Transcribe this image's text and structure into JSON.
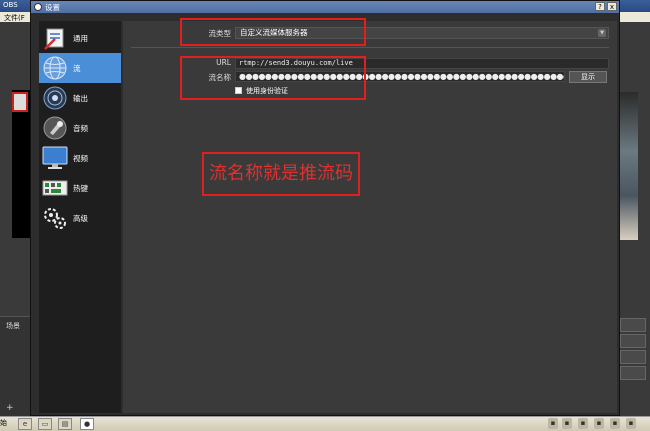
{
  "main_window": {
    "title": "OBS",
    "menu_item": "文件(F",
    "scene_label": "场景",
    "add_button": "+",
    "remove_button": "−"
  },
  "dialog": {
    "title": "设置",
    "controls": [
      "?",
      "x"
    ]
  },
  "sidebar": {
    "items": [
      {
        "label": "通用",
        "icon": "general-icon"
      },
      {
        "label": "流",
        "icon": "stream-icon",
        "active": true
      },
      {
        "label": "输出",
        "icon": "output-icon"
      },
      {
        "label": "音频",
        "icon": "audio-icon"
      },
      {
        "label": "视频",
        "icon": "video-icon"
      },
      {
        "label": "热键",
        "icon": "hotkeys-icon"
      },
      {
        "label": "高级",
        "icon": "advanced-icon"
      }
    ]
  },
  "stream": {
    "type_label": "流类型",
    "type_value": "自定义流媒体服务器",
    "url_label": "URL",
    "url_value": "rtmp://send3.douyu.com/live",
    "key_label": "流名称",
    "key_value": "●●●●●●●●●●●●●●●●●●●●●●●●●●●●●●●●●●●●●●●●●●●●●●●●●●●●●●●●●●●●●●",
    "show_button": "显示",
    "auth_checkbox_label": "使用身份验证",
    "auth_checked": false
  },
  "annotation": {
    "text": "流名称就是推流码",
    "color": "#e02020"
  },
  "taskbar": {
    "start_text": "始"
  },
  "colors": {
    "active_item": "#4a8ed8",
    "dialog_bg": "#2d2d2d",
    "content_bg": "#3a3a3a"
  }
}
